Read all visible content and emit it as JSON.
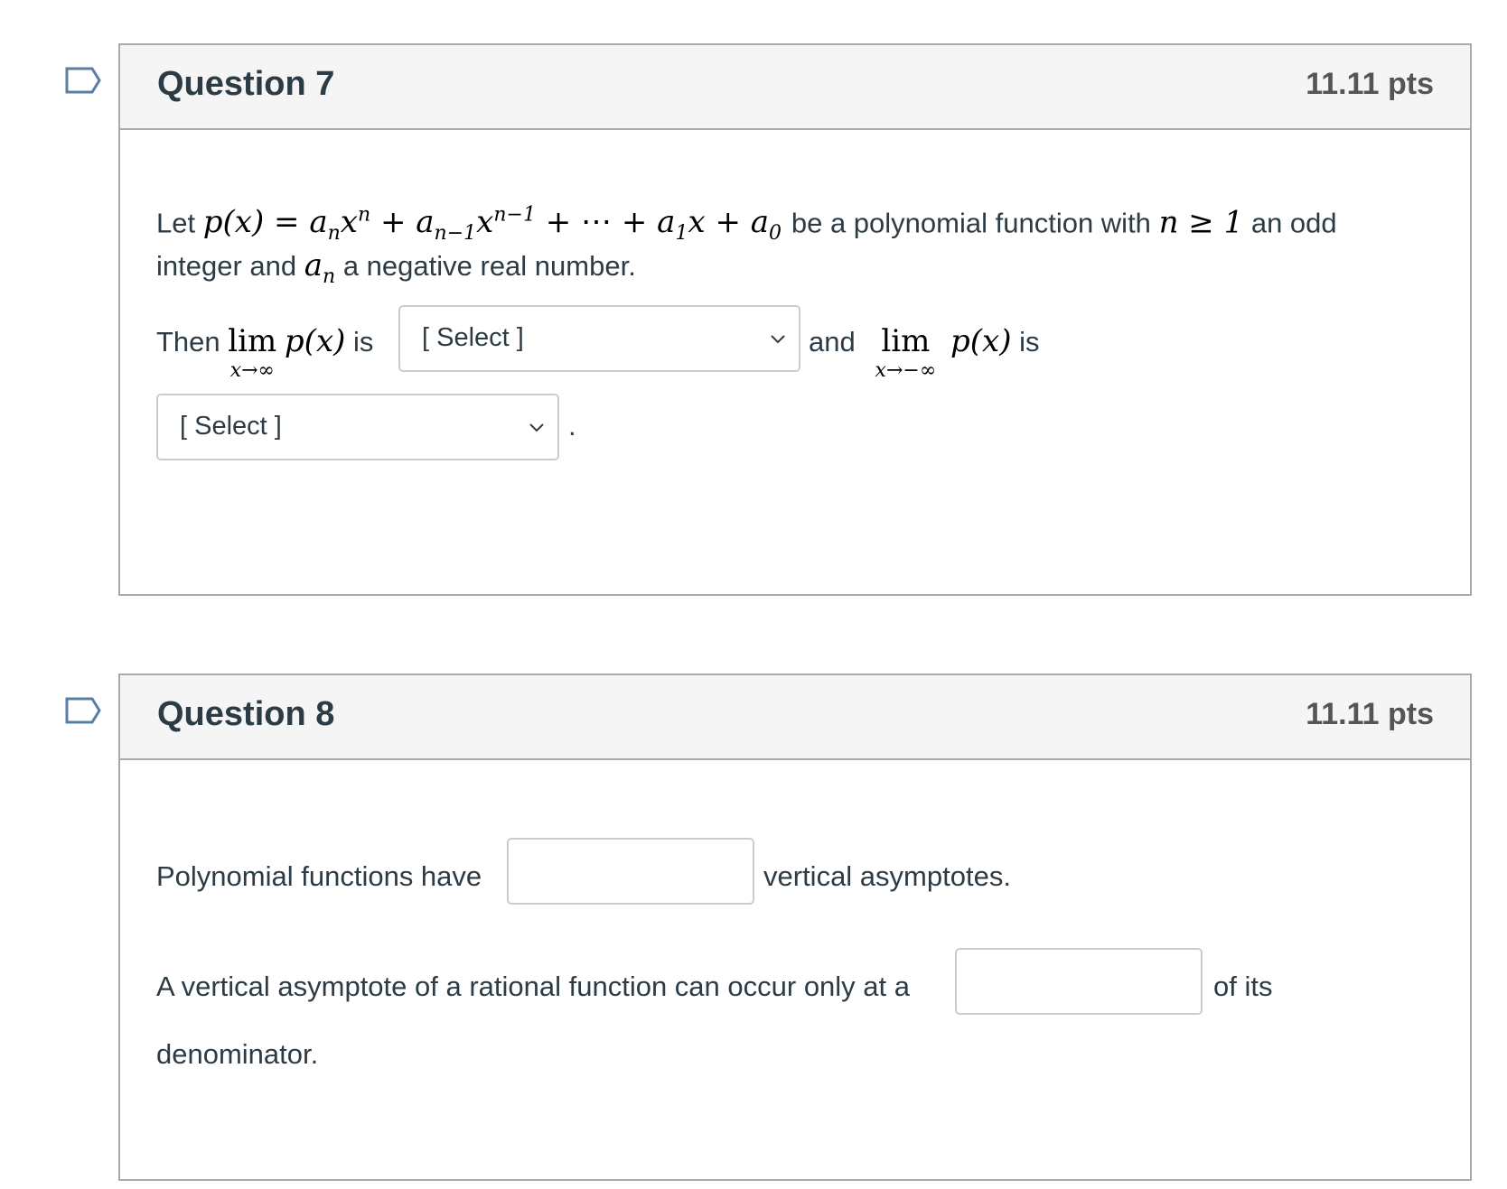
{
  "questions": [
    {
      "title": "Question 7",
      "points": "11.11 pts",
      "body": {
        "line1_prefix": "Let",
        "formula": {
          "p": "p(x)",
          "eq": "=",
          "term1": "a",
          "term1_sub": "n",
          "term1_var": "x",
          "term1_sup": "n",
          "plus": "+",
          "term2": "a",
          "term2_sub": "n−1",
          "term2_var": "x",
          "term2_sup": "n−1",
          "dots": "+ ⋯ +",
          "term3": "a",
          "term3_sub": "1",
          "term3_var": "x",
          "term4": "a",
          "term4_sub": "0"
        },
        "line1_mid": "be a polynomial function with",
        "cond": "n ≥ 1",
        "line1_suffix": "an odd",
        "line2_prefix": "integer and",
        "line2_var": "a",
        "line2_sub": "n",
        "line2_suffix": "a negative real number.",
        "then": "Then",
        "lim_word": "lim",
        "lim1_sub": "x→∞",
        "lim_fn": "p(x)",
        "is": "is",
        "and": "and",
        "lim2_sub": "x→−∞",
        "period": ".",
        "select1": "[ Select ]",
        "select2": "[ Select ]"
      }
    },
    {
      "title": "Question 8",
      "points": "11.11 pts",
      "body": {
        "s1_prefix": "Polynomial functions have",
        "s1_input": "",
        "s1_suffix": "vertical asymptotes.",
        "s2_prefix": "A vertical asymptote of a rational function can occur only at a",
        "s2_input": "",
        "s2_suffix": "of its",
        "s2_cont": "denominator."
      }
    }
  ],
  "colors": {
    "flag": "#5a7ea3",
    "border": "#aaaaaa",
    "header_bg": "#f5f5f5",
    "text": "#2d3b45",
    "points": "#555555"
  }
}
